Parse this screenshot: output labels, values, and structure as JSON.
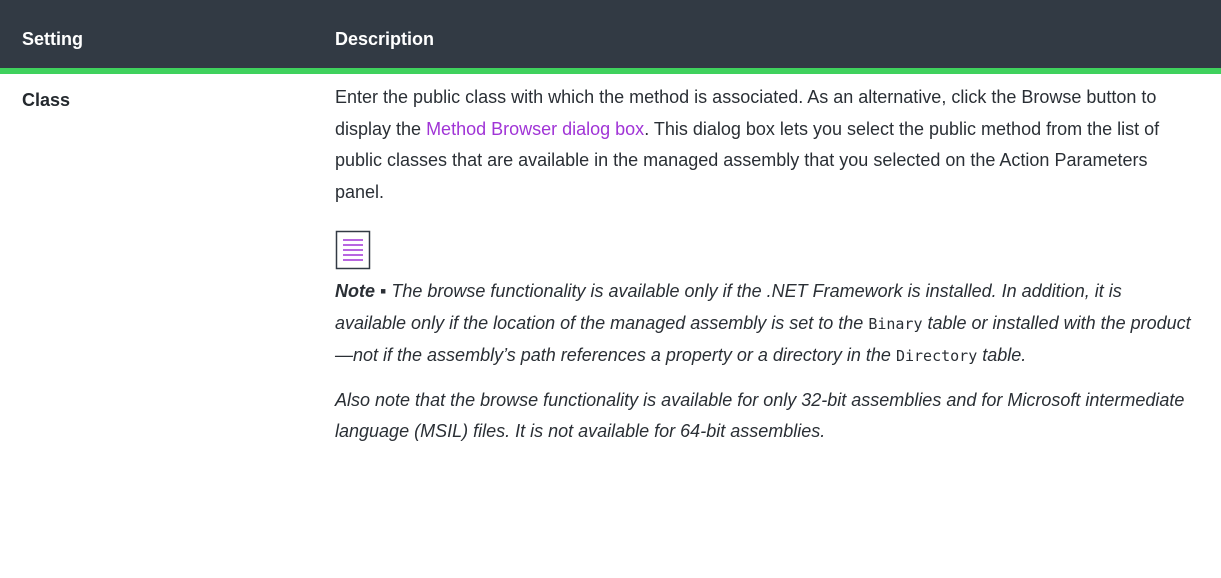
{
  "table": {
    "headers": {
      "setting": "Setting",
      "description": "Description"
    },
    "row": {
      "setting": "Class",
      "desc_text1": "Enter the public class with which the method is associated. As an alternative, click the Browse button to display the ",
      "desc_link": "Method Browser dialog box",
      "desc_text2": ". This dialog box lets you select the public method from the list of public classes that are available in the managed assembly that you selected on the Action Parameters panel.",
      "note_icon": "note-icon",
      "note_lead": "Note ▪",
      "note_text1": " The browse functionality is available only if the .NET Framework is installed. In addition, it is available only if the location of the managed assembly is set to the ",
      "note_code1": "Binary",
      "note_text2": " table or installed with the product—not if the assembly’s path references a property or a directory in the ",
      "note_code2": "Directory",
      "note_text3": " table.",
      "note_p2": "Also note that the browse functionality is available for only 32-bit assemblies and for Microsoft intermediate language (MSIL) files. It is not available for 64-bit assemblies."
    }
  },
  "colors": {
    "header_bg": "#323a44",
    "accent_green": "#3fd15d",
    "link": "#a034d6"
  }
}
